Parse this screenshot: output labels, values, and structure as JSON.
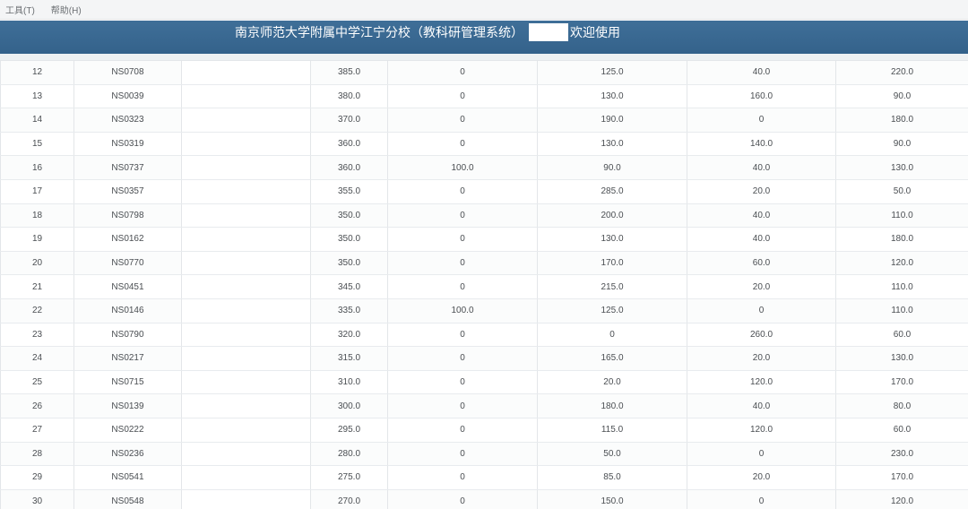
{
  "menubar": {
    "items": [
      {
        "label": "工具(T)"
      },
      {
        "label": "帮助(H)"
      }
    ]
  },
  "banner": {
    "title_left": "南京师范大学附属中学江宁分校（教科研管理系统）",
    "title_right": "欢迎使用"
  },
  "table": {
    "rows": [
      {
        "idx": "12",
        "id": "NS0708",
        "total": "385.0",
        "c1": "0",
        "c2": "125.0",
        "c3": "40.0",
        "c4": "220.0"
      },
      {
        "idx": "13",
        "id": "NS0039",
        "total": "380.0",
        "c1": "0",
        "c2": "130.0",
        "c3": "160.0",
        "c4": "90.0"
      },
      {
        "idx": "14",
        "id": "NS0323",
        "total": "370.0",
        "c1": "0",
        "c2": "190.0",
        "c3": "0",
        "c4": "180.0"
      },
      {
        "idx": "15",
        "id": "NS0319",
        "total": "360.0",
        "c1": "0",
        "c2": "130.0",
        "c3": "140.0",
        "c4": "90.0"
      },
      {
        "idx": "16",
        "id": "NS0737",
        "total": "360.0",
        "c1": "100.0",
        "c2": "90.0",
        "c3": "40.0",
        "c4": "130.0"
      },
      {
        "idx": "17",
        "id": "NS0357",
        "total": "355.0",
        "c1": "0",
        "c2": "285.0",
        "c3": "20.0",
        "c4": "50.0"
      },
      {
        "idx": "18",
        "id": "NS0798",
        "total": "350.0",
        "c1": "0",
        "c2": "200.0",
        "c3": "40.0",
        "c4": "110.0"
      },
      {
        "idx": "19",
        "id": "NS0162",
        "total": "350.0",
        "c1": "0",
        "c2": "130.0",
        "c3": "40.0",
        "c4": "180.0"
      },
      {
        "idx": "20",
        "id": "NS0770",
        "total": "350.0",
        "c1": "0",
        "c2": "170.0",
        "c3": "60.0",
        "c4": "120.0"
      },
      {
        "idx": "21",
        "id": "NS0451",
        "total": "345.0",
        "c1": "0",
        "c2": "215.0",
        "c3": "20.0",
        "c4": "110.0"
      },
      {
        "idx": "22",
        "id": "NS0146",
        "total": "335.0",
        "c1": "100.0",
        "c2": "125.0",
        "c3": "0",
        "c4": "110.0"
      },
      {
        "idx": "23",
        "id": "NS0790",
        "total": "320.0",
        "c1": "0",
        "c2": "0",
        "c3": "260.0",
        "c4": "60.0"
      },
      {
        "idx": "24",
        "id": "NS0217",
        "total": "315.0",
        "c1": "0",
        "c2": "165.0",
        "c3": "20.0",
        "c4": "130.0"
      },
      {
        "idx": "25",
        "id": "NS0715",
        "total": "310.0",
        "c1": "0",
        "c2": "20.0",
        "c3": "120.0",
        "c4": "170.0"
      },
      {
        "idx": "26",
        "id": "NS0139",
        "total": "300.0",
        "c1": "0",
        "c2": "180.0",
        "c3": "40.0",
        "c4": "80.0"
      },
      {
        "idx": "27",
        "id": "NS0222",
        "total": "295.0",
        "c1": "0",
        "c2": "115.0",
        "c3": "120.0",
        "c4": "60.0"
      },
      {
        "idx": "28",
        "id": "NS0236",
        "total": "280.0",
        "c1": "0",
        "c2": "50.0",
        "c3": "0",
        "c4": "230.0"
      },
      {
        "idx": "29",
        "id": "NS0541",
        "total": "275.0",
        "c1": "0",
        "c2": "85.0",
        "c3": "20.0",
        "c4": "170.0"
      },
      {
        "idx": "30",
        "id": "NS0548",
        "total": "270.0",
        "c1": "0",
        "c2": "150.0",
        "c3": "0",
        "c4": "120.0"
      }
    ]
  }
}
